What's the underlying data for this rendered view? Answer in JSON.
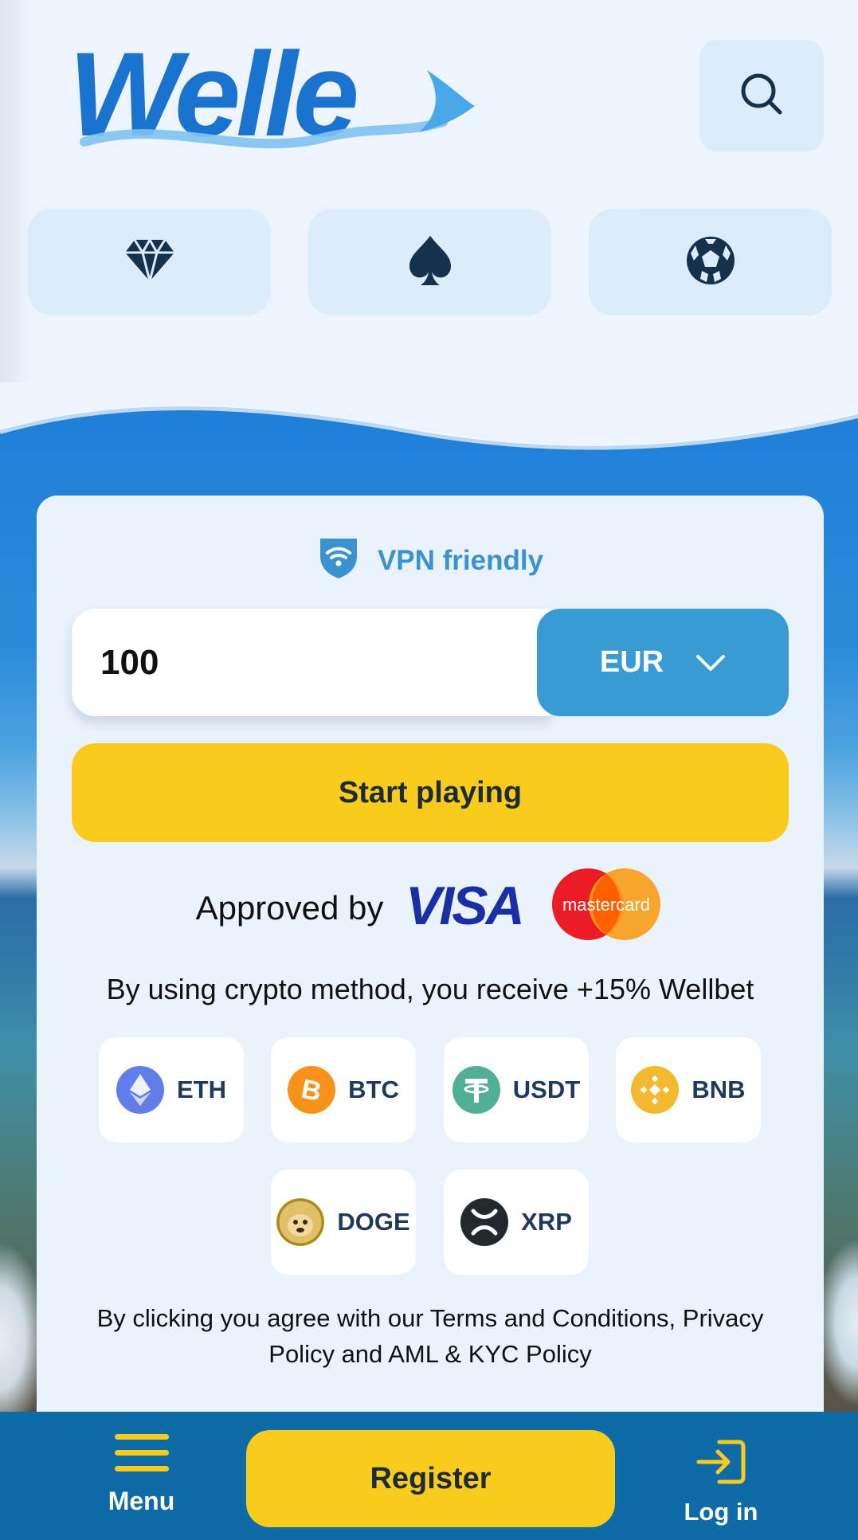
{
  "brand": {
    "logo_text": "Welle"
  },
  "header": {
    "search_icon": "search-icon",
    "categories": [
      {
        "name": "casino",
        "icon": "diamond-icon"
      },
      {
        "name": "poker",
        "icon": "spade-icon"
      },
      {
        "name": "sports",
        "icon": "soccer-ball-icon"
      }
    ]
  },
  "deposit": {
    "vpn_label": "VPN friendly",
    "amount": "100",
    "currency": "EUR",
    "start_label": "Start playing",
    "approved_label": "Approved by",
    "visa_text": "VISA",
    "mastercard_text": "mastercard",
    "crypto_note": "By using crypto method, you receive +15% Wellbet",
    "coins": [
      {
        "code": "ETH",
        "color": "#627eea"
      },
      {
        "code": "BTC",
        "color": "#f7931a"
      },
      {
        "code": "USDT",
        "color": "#50af95"
      },
      {
        "code": "BNB",
        "color": "#f3ba2f"
      },
      {
        "code": "DOGE",
        "color": "#c2a633"
      },
      {
        "code": "XRP",
        "color": "#23292f"
      }
    ],
    "terms": "By clicking you agree with our Terms and Conditions, Privacy Policy and AML & KYC Policy"
  },
  "bottom_nav": {
    "menu_label": "Menu",
    "register_label": "Register",
    "login_label": "Log in"
  },
  "colors": {
    "accent_yellow": "#f9cb1c",
    "accent_blue": "#3a9bd4",
    "nav_blue": "#0f6aa8"
  }
}
